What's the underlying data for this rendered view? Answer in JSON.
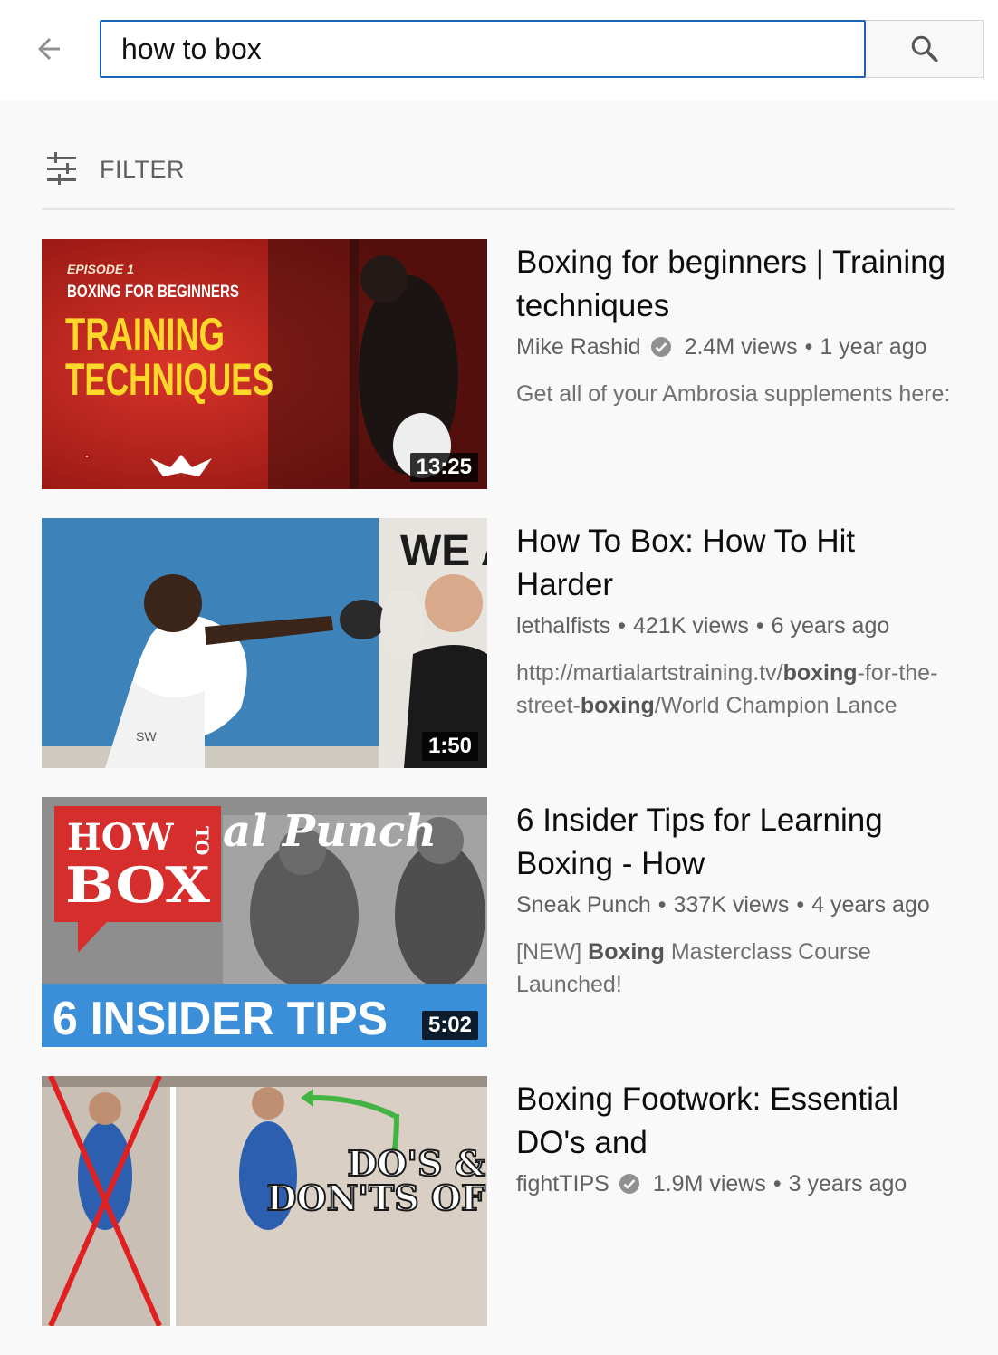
{
  "search": {
    "query": "how to box"
  },
  "filter": {
    "label": "FILTER"
  },
  "videos": [
    {
      "title": "Boxing for beginners | Training techniques",
      "channel": "Mike Rashid",
      "verified": true,
      "views": "2.4M views",
      "age": "1 year ago",
      "description": [
        {
          "t": "Get all of your Ambrosia supplements here:",
          "b": false
        }
      ],
      "duration": "13:25",
      "thumb_text": {
        "episode": "EPISODE 1",
        "series": "BOXING FOR BEGINNERS",
        "line1": "TRAINING",
        "line2": "TECHNIQUES"
      }
    },
    {
      "title": "How To Box: How To Hit Harder",
      "channel": "lethalfists",
      "verified": false,
      "views": "421K views",
      "age": "6 years ago",
      "description": [
        {
          "t": "http://martialartstraining.tv/",
          "b": false
        },
        {
          "t": "boxing",
          "b": true
        },
        {
          "t": "-for-the-street-",
          "b": false
        },
        {
          "t": "boxing",
          "b": true
        },
        {
          "t": "/World Champion Lance",
          "b": false
        }
      ],
      "duration": "1:50",
      "thumb_text": {
        "wall": "WE A",
        "shorts": "SW"
      }
    },
    {
      "title": "6 Insider Tips for Learning Boxing - How",
      "channel": "Sneak Punch",
      "verified": false,
      "views": "337K views",
      "age": "4 years ago",
      "description": [
        {
          "t": "[NEW] ",
          "b": false
        },
        {
          "t": "Boxing",
          "b": true
        },
        {
          "t": " Masterclass Course Launched!",
          "b": false
        }
      ],
      "duration": "5:02",
      "thumb_text": {
        "how": "HOW",
        "to": "TO",
        "box": "BOX",
        "script": "al Punch",
        "tips": "6 INSIDER TIPS"
      }
    },
    {
      "title": "Boxing Footwork: Essential DO's and",
      "channel": "fightTIPS",
      "verified": true,
      "views": "1.9M views",
      "age": "3 years ago",
      "description": [],
      "duration": "",
      "thumb_text": {
        "line1": "DO'S &",
        "line2": "DON'TS OF"
      }
    }
  ],
  "colors": {
    "search_border": "#1c62b9",
    "title": "#0d0d0d",
    "meta": "#606060",
    "background": "#f9f9f9"
  },
  "icons": [
    "back-arrow-icon",
    "search-icon",
    "filter-sliders-icon",
    "verified-check-icon"
  ]
}
